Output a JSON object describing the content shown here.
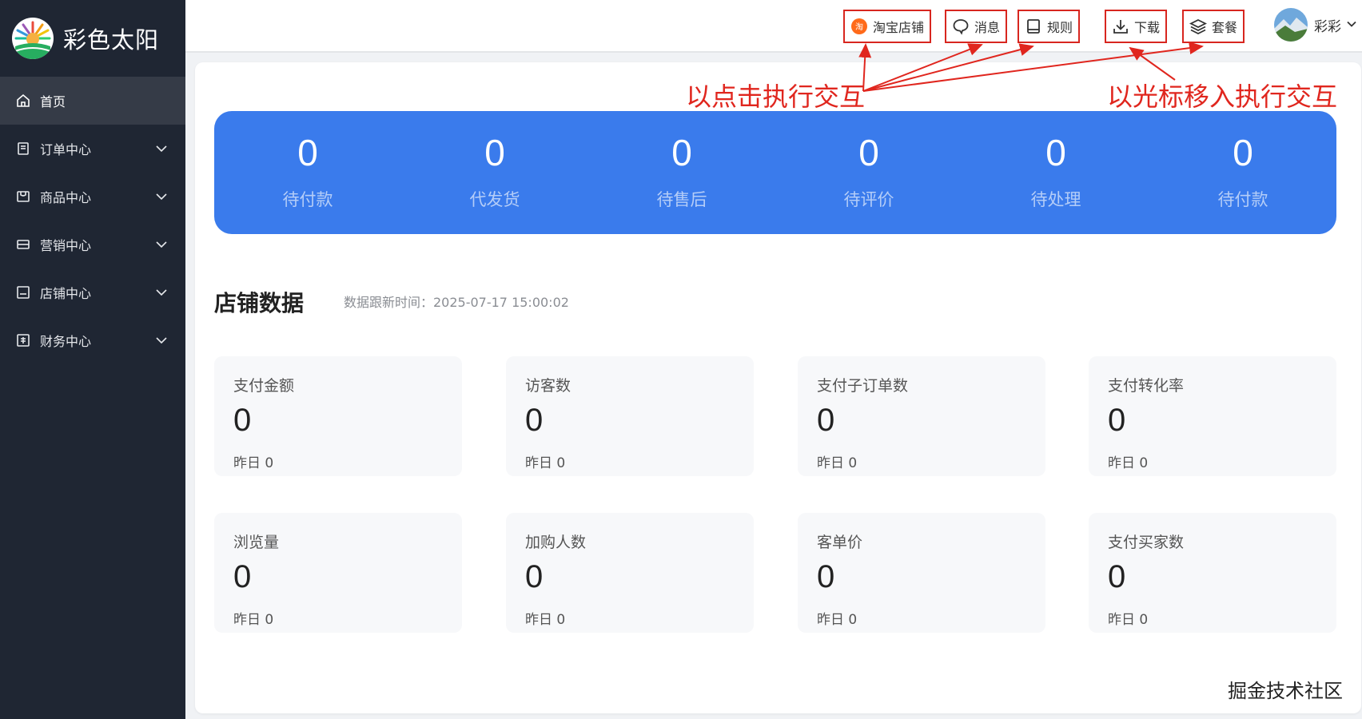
{
  "brand": {
    "name": "彩色太阳"
  },
  "sidebar": {
    "items": [
      {
        "label": "首页",
        "icon": "home-icon"
      },
      {
        "label": "订单中心",
        "icon": "order-icon"
      },
      {
        "label": "商品中心",
        "icon": "product-icon"
      },
      {
        "label": "营销中心",
        "icon": "marketing-icon"
      },
      {
        "label": "店铺中心",
        "icon": "store-icon"
      },
      {
        "label": "财务中心",
        "icon": "finance-icon"
      }
    ]
  },
  "header": {
    "buttons": [
      {
        "label": "淘宝店铺",
        "icon": "taobao-icon"
      },
      {
        "label": "消息",
        "icon": "message-icon"
      },
      {
        "label": "规则",
        "icon": "book-icon"
      },
      {
        "label": "下载",
        "icon": "download-icon"
      },
      {
        "label": "套餐",
        "icon": "layers-icon"
      }
    ],
    "user": {
      "name": "彩彩"
    }
  },
  "annotations": {
    "click": "以点击执行交互",
    "hover": "以光标移入执行交互",
    "color": "#e0261e"
  },
  "stats": [
    {
      "value": "0",
      "label": "待付款"
    },
    {
      "value": "0",
      "label": "代发货"
    },
    {
      "value": "0",
      "label": "待售后"
    },
    {
      "value": "0",
      "label": "待评价"
    },
    {
      "value": "0",
      "label": "待处理"
    },
    {
      "value": "0",
      "label": "待付款"
    }
  ],
  "store_data": {
    "title": "店铺数据",
    "update_time": "数据跟新时间：2025-07-17 15:00:02",
    "metrics": [
      {
        "title": "支付金额",
        "value": "0",
        "yesterday": "昨日 0"
      },
      {
        "title": "访客数",
        "value": "0",
        "yesterday": "昨日 0"
      },
      {
        "title": "支付子订单数",
        "value": "0",
        "yesterday": "昨日 0"
      },
      {
        "title": "支付转化率",
        "value": "0",
        "yesterday": "昨日 0"
      },
      {
        "title": "浏览量",
        "value": "0",
        "yesterday": "昨日 0"
      },
      {
        "title": "加购人数",
        "value": "0",
        "yesterday": "昨日 0"
      },
      {
        "title": "客单价",
        "value": "0",
        "yesterday": "昨日 0"
      },
      {
        "title": "支付买家数",
        "value": "0",
        "yesterday": "昨日 0"
      }
    ]
  },
  "watermark": "掘金技术社区",
  "colors": {
    "sidebar": "#1f2633",
    "accent": "#3a7bec",
    "annotation": "#e0261e"
  }
}
